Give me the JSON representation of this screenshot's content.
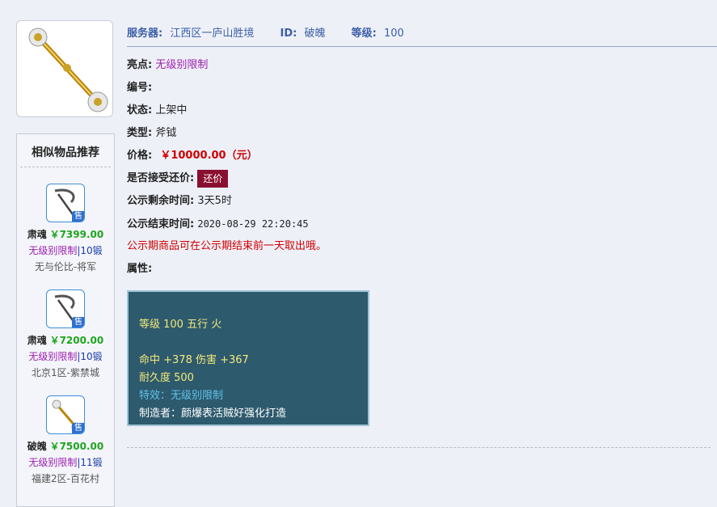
{
  "item": {
    "icon": "golden-scepter-icon"
  },
  "similar": {
    "title": "相似物品推荐",
    "sale_badge": "售",
    "items": [
      {
        "icon": "scythe-icon",
        "name": "肃魂",
        "price": "￥7399.00",
        "tag": "无级别限制",
        "sep": "|",
        "level": "10锻",
        "server": "无与伦比-将军"
      },
      {
        "icon": "scythe-icon",
        "name": "肃魂",
        "price": "￥7200.00",
        "tag": "无级别限制",
        "sep": "|",
        "level": "10锻",
        "server": "北京1区-紫禁城"
      },
      {
        "icon": "golden-scepter-icon",
        "name": "破魄",
        "price": "￥7500.00",
        "tag": "无级别限制",
        "sep": "|",
        "level": "11锻",
        "server": "福建2区-百花村"
      }
    ]
  },
  "header": {
    "server_label": "服务器:",
    "server_value": "江西区一庐山胜境",
    "id_label": "ID:",
    "id_value": "破魄",
    "level_label": "等级:",
    "level_value": "100"
  },
  "details": {
    "highlight_label": "亮点:",
    "highlight_value": "无级别限制",
    "serial_label": "编号:",
    "serial_value": "",
    "status_label": "状态:",
    "status_value": "上架中",
    "type_label": "类型:",
    "type_value": "斧钺",
    "price_label": "价格:",
    "price_value": "￥10000.00（元）",
    "counter_label": "是否接受还价:",
    "counter_button": "还价",
    "remaining_label": "公示剩余时间:",
    "remaining_value": "3天5时",
    "end_label": "公示结束时间:",
    "end_value": "2020-08-29 22:20:45",
    "notice": "公示期商品可在公示期结束前一天取出哦。",
    "attributes_label": "属性:"
  },
  "attributes": {
    "line1": "等级 100 五行 火",
    "line2": "命中 +378 伤害 +367",
    "line3": "耐久度 500",
    "line4": "特效：无级别限制",
    "line5": "制造者：颜爆表活贼好强化打造"
  }
}
